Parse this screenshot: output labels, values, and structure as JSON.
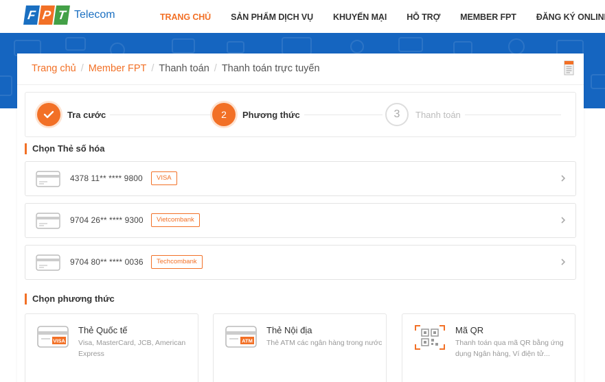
{
  "brand": {
    "logo_letters": [
      "F",
      "P",
      "T"
    ],
    "logo_text": "Telecom",
    "accent": "#f27026",
    "blue": "#1565c0"
  },
  "nav": [
    {
      "label": "TRANG CHỦ",
      "active": true
    },
    {
      "label": "SẢN PHẨM DỊCH VỤ"
    },
    {
      "label": "KHUYẾN MẠI"
    },
    {
      "label": "HỖ TRỢ"
    },
    {
      "label": "MEMBER FPT"
    },
    {
      "label": "ĐĂNG KÝ ONLINE"
    }
  ],
  "breadcrumb": [
    "Trang chủ",
    "Member FPT",
    "Thanh toán",
    "Thanh toán trực tuyến"
  ],
  "steps": [
    {
      "number": "",
      "label": "Tra cước",
      "state": "done",
      "icon": "check-icon"
    },
    {
      "number": "2",
      "label": "Phương thức",
      "state": "current"
    },
    {
      "number": "3",
      "label": "Thanh toán",
      "state": "todo"
    }
  ],
  "saved_cards_title": "Chọn Thẻ số hóa",
  "saved_cards": [
    {
      "number": "4378 11** **** 9800",
      "bank": "VISA"
    },
    {
      "number": "9704 26** **** 9300",
      "bank": "Vietcombank"
    },
    {
      "number": "9704 80** **** 0036",
      "bank": "Techcombank"
    }
  ],
  "methods_title": "Chọn phương thức",
  "methods": [
    {
      "title": "Thẻ Quốc tế",
      "desc": "Visa, MasterCard, JCB, American Express",
      "icon_tag": "VISA",
      "icon": "visa-card-icon"
    },
    {
      "title": "Thẻ Nội địa",
      "desc": "Thẻ ATM các ngân hàng trong nước",
      "icon_tag": "ATM",
      "icon": "atm-card-icon"
    },
    {
      "title": "Mã QR",
      "desc": "Thanh toán qua mã QR bằng ứng dụng Ngân hàng, Ví điện tử...",
      "icon": "qr-code-icon"
    }
  ]
}
